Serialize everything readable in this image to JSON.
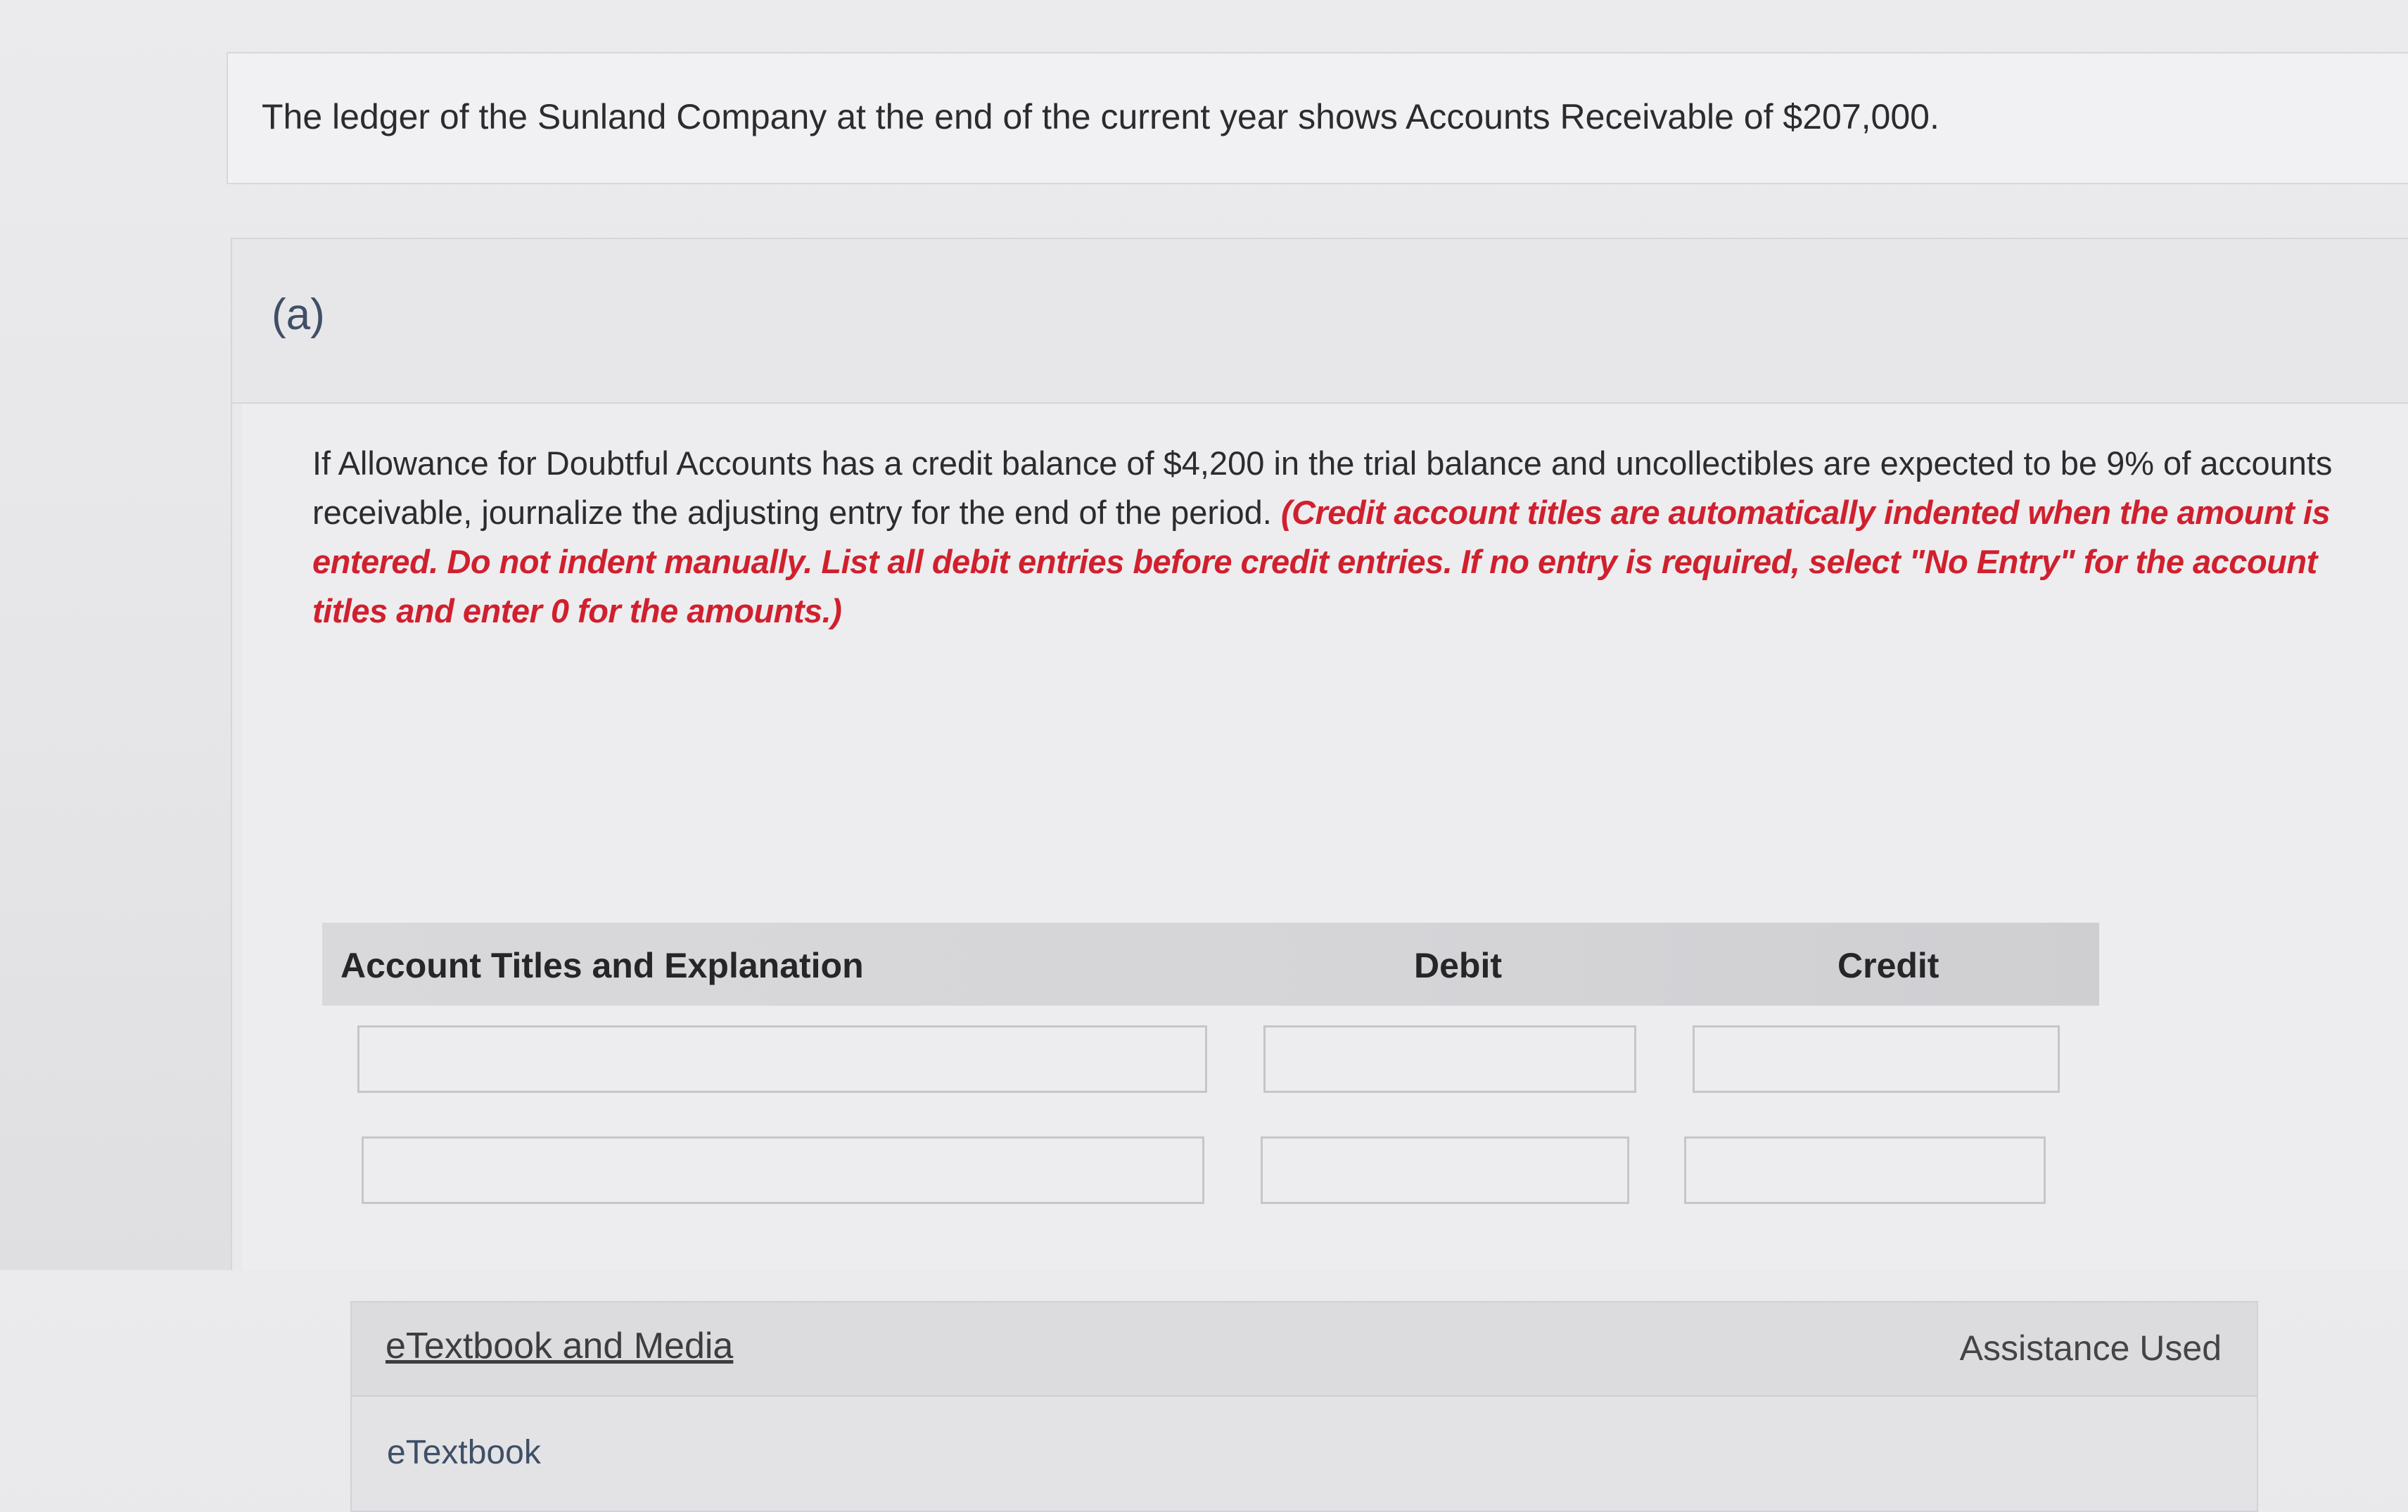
{
  "intro": {
    "text": "The ledger of the Sunland Company at the end of the current year shows Accounts Receivable of $207,000."
  },
  "part": {
    "label": "(a)",
    "question": "If Allowance for Doubtful Accounts has a credit balance of $4,200 in the trial balance and uncollectibles are expected to be 9% of accounts receivable, journalize the adjusting entry for the end of the period.",
    "instructions": "(Credit account titles are automatically indented when the amount is entered. Do not indent manually. List all debit entries before credit entries. If no entry is required, select \"No Entry\" for the account titles and enter 0 for the amounts.)"
  },
  "journal": {
    "headers": {
      "account": "Account Titles and Explanation",
      "debit": "Debit",
      "credit": "Credit"
    },
    "rows": [
      {
        "account": "",
        "debit": "",
        "credit": ""
      },
      {
        "account": "",
        "debit": "",
        "credit": ""
      }
    ]
  },
  "media": {
    "link_label": "eTextbook and Media",
    "assistance_label": "Assistance Used",
    "items": [
      "eTextbook"
    ]
  },
  "colors": {
    "instruction_red": "#d0202e",
    "part_label": "#3f4f66"
  }
}
